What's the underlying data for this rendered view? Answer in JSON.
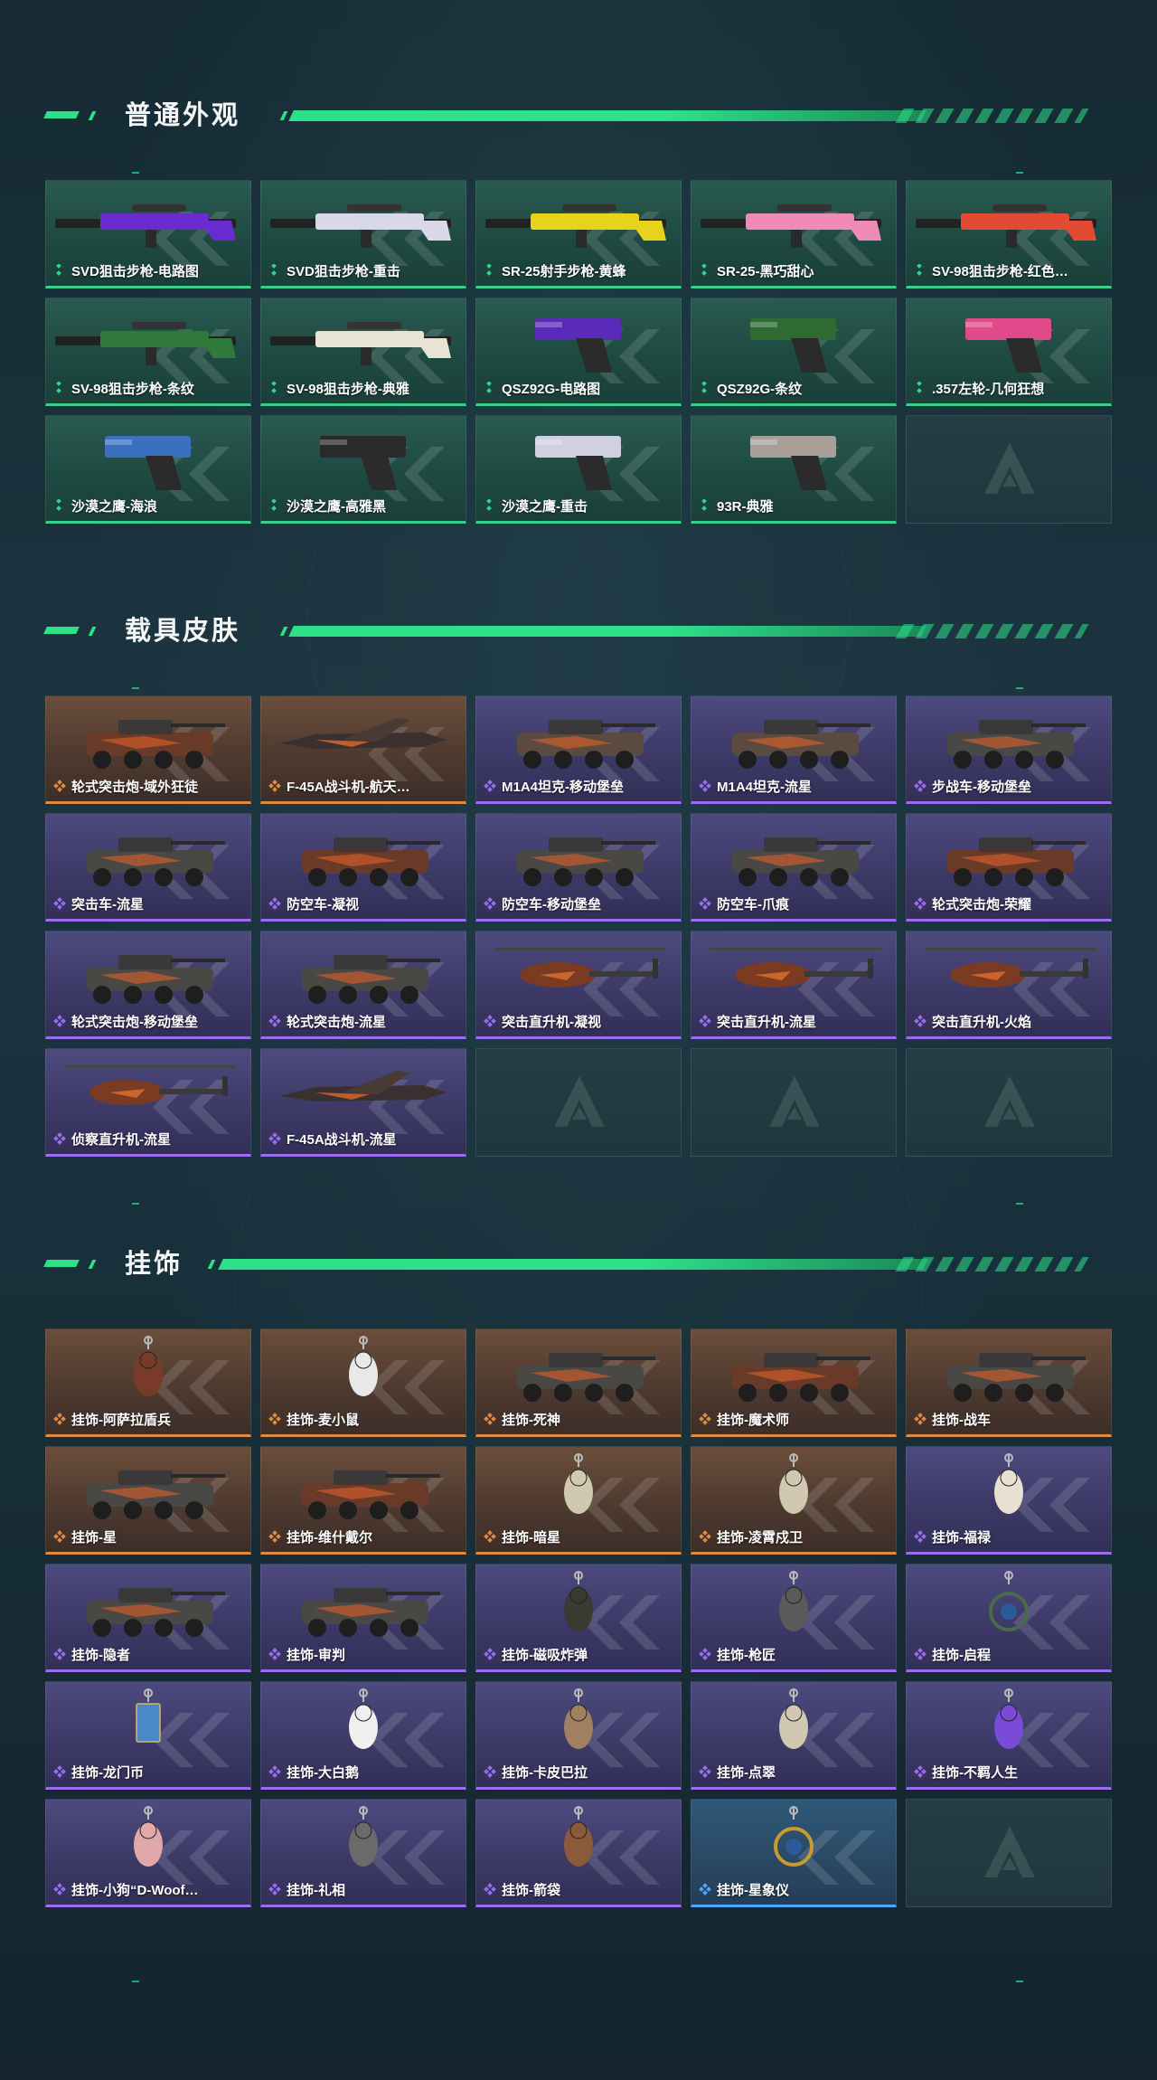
{
  "sections": [
    {
      "title": "普通外观",
      "items": [
        {
          "label": "SVD狙击步枪-电路图",
          "rarity": "green",
          "icon": "sniper-rifle-icon"
        },
        {
          "label": "SVD狙击步枪-重击",
          "rarity": "green",
          "icon": "sniper-rifle-icon"
        },
        {
          "label": "SR-25射手步枪-黄蜂",
          "rarity": "green",
          "icon": "marksman-rifle-icon"
        },
        {
          "label": "SR-25-黑巧甜心",
          "rarity": "green",
          "icon": "marksman-rifle-icon"
        },
        {
          "label": "SV-98狙击步枪-红色…",
          "rarity": "green",
          "icon": "sniper-rifle-icon"
        },
        {
          "label": "SV-98狙击步枪-条纹",
          "rarity": "green",
          "icon": "sniper-rifle-icon"
        },
        {
          "label": "SV-98狙击步枪-典雅",
          "rarity": "green",
          "icon": "sniper-rifle-icon"
        },
        {
          "label": "QSZ92G-电路图",
          "rarity": "green",
          "icon": "pistol-icon"
        },
        {
          "label": "QSZ92G-条纹",
          "rarity": "green",
          "icon": "pistol-icon"
        },
        {
          "label": ".357左轮-几何狂想",
          "rarity": "green",
          "icon": "revolver-icon"
        },
        {
          "label": "沙漠之鹰-海浪",
          "rarity": "green",
          "icon": "pistol-icon"
        },
        {
          "label": "沙漠之鹰-高雅黑",
          "rarity": "green",
          "icon": "pistol-icon"
        },
        {
          "label": "沙漠之鹰-重击",
          "rarity": "green",
          "icon": "pistol-icon"
        },
        {
          "label": "93R-典雅",
          "rarity": "green",
          "icon": "pistol-icon"
        },
        {
          "label": "",
          "rarity": "empty",
          "icon": "logo-watermark-icon"
        }
      ]
    },
    {
      "title": "载具皮肤",
      "items": [
        {
          "label": "轮式突击炮-域外狂徒",
          "rarity": "orange",
          "icon": "armored-car-icon"
        },
        {
          "label": "F-45A战斗机-航天…",
          "rarity": "orange",
          "icon": "fighter-jet-icon"
        },
        {
          "label": "M1A4坦克-移动堡垒",
          "rarity": "purple",
          "icon": "tank-icon"
        },
        {
          "label": "M1A4坦克-流星",
          "rarity": "purple",
          "icon": "tank-icon"
        },
        {
          "label": "步战车-移动堡垒",
          "rarity": "purple",
          "icon": "ifv-icon"
        },
        {
          "label": "突击车-流星",
          "rarity": "purple",
          "icon": "assault-vehicle-icon"
        },
        {
          "label": "防空车-凝视",
          "rarity": "purple",
          "icon": "aa-vehicle-icon"
        },
        {
          "label": "防空车-移动堡垒",
          "rarity": "purple",
          "icon": "aa-vehicle-icon"
        },
        {
          "label": "防空车-爪痕",
          "rarity": "purple",
          "icon": "aa-vehicle-icon"
        },
        {
          "label": "轮式突击炮-荣耀",
          "rarity": "purple",
          "icon": "armored-car-icon"
        },
        {
          "label": "轮式突击炮-移动堡垒",
          "rarity": "purple",
          "icon": "armored-car-icon"
        },
        {
          "label": "轮式突击炮-流星",
          "rarity": "purple",
          "icon": "armored-car-icon"
        },
        {
          "label": "突击直升机-凝视",
          "rarity": "purple",
          "icon": "attack-helicopter-icon"
        },
        {
          "label": "突击直升机-流星",
          "rarity": "purple",
          "icon": "attack-helicopter-icon"
        },
        {
          "label": "突击直升机-火焰",
          "rarity": "purple",
          "icon": "attack-helicopter-icon"
        },
        {
          "label": "侦察直升机-流星",
          "rarity": "purple",
          "icon": "scout-helicopter-icon"
        },
        {
          "label": "F-45A战斗机-流星",
          "rarity": "purple",
          "icon": "fighter-jet-icon"
        },
        {
          "label": "",
          "rarity": "empty",
          "icon": "logo-watermark-icon"
        },
        {
          "label": "",
          "rarity": "empty",
          "icon": "logo-watermark-icon"
        },
        {
          "label": "",
          "rarity": "empty",
          "icon": "logo-watermark-icon"
        }
      ]
    },
    {
      "title": "挂饰",
      "items": [
        {
          "label": "挂饰-阿萨拉盾兵",
          "rarity": "orange",
          "icon": "charm-figure-icon"
        },
        {
          "label": "挂饰-麦小鼠",
          "rarity": "orange",
          "icon": "charm-mouse-icon"
        },
        {
          "label": "挂饰-死神",
          "rarity": "orange",
          "icon": "charm-card-icon"
        },
        {
          "label": "挂饰-魔术师",
          "rarity": "orange",
          "icon": "charm-card-icon"
        },
        {
          "label": "挂饰-战车",
          "rarity": "orange",
          "icon": "charm-card-icon"
        },
        {
          "label": "挂饰-星",
          "rarity": "orange",
          "icon": "charm-card-icon"
        },
        {
          "label": "挂饰-维什戴尔",
          "rarity": "orange",
          "icon": "charm-card-icon"
        },
        {
          "label": "挂饰-暗星",
          "rarity": "orange",
          "icon": "charm-bird-icon"
        },
        {
          "label": "挂饰-凌霄戍卫",
          "rarity": "orange",
          "icon": "charm-bird-icon"
        },
        {
          "label": "挂饰-福禄",
          "rarity": "purple",
          "icon": "charm-panda-icon"
        },
        {
          "label": "挂饰-隐者",
          "rarity": "purple",
          "icon": "charm-card-icon"
        },
        {
          "label": "挂饰-审判",
          "rarity": "purple",
          "icon": "charm-card-icon"
        },
        {
          "label": "挂饰-磁吸炸弹",
          "rarity": "purple",
          "icon": "charm-bomb-icon"
        },
        {
          "label": "挂饰-枪匠",
          "rarity": "purple",
          "icon": "charm-box-icon"
        },
        {
          "label": "挂饰-启程",
          "rarity": "purple",
          "icon": "charm-badge-icon"
        },
        {
          "label": "挂饰-龙门币",
          "rarity": "purple",
          "icon": "charm-coin-icon"
        },
        {
          "label": "挂饰-大白鹅",
          "rarity": "purple",
          "icon": "charm-goose-icon"
        },
        {
          "label": "挂饰-卡皮巴拉",
          "rarity": "purple",
          "icon": "charm-capybara-icon"
        },
        {
          "label": "挂饰-点翠",
          "rarity": "purple",
          "icon": "charm-bird-icon"
        },
        {
          "label": "挂饰-不羁人生",
          "rarity": "purple",
          "icon": "charm-shoe-icon"
        },
        {
          "label": "挂饰-小狗“D-Woof…",
          "rarity": "purple",
          "icon": "charm-dog-icon"
        },
        {
          "label": "挂饰-礼相",
          "rarity": "purple",
          "icon": "charm-hat-icon"
        },
        {
          "label": "挂饰-箭袋",
          "rarity": "purple",
          "icon": "charm-quiver-icon"
        },
        {
          "label": "挂饰-星象仪",
          "rarity": "blue",
          "icon": "charm-astrolabe-icon"
        },
        {
          "label": "",
          "rarity": "empty",
          "icon": "logo-watermark-icon"
        }
      ]
    }
  ],
  "colors": {
    "accent": "#2ee08a",
    "green": "#36d08a",
    "orange": "#e08a40",
    "purple": "#9b6ef0",
    "blue": "#4aa6ff"
  }
}
